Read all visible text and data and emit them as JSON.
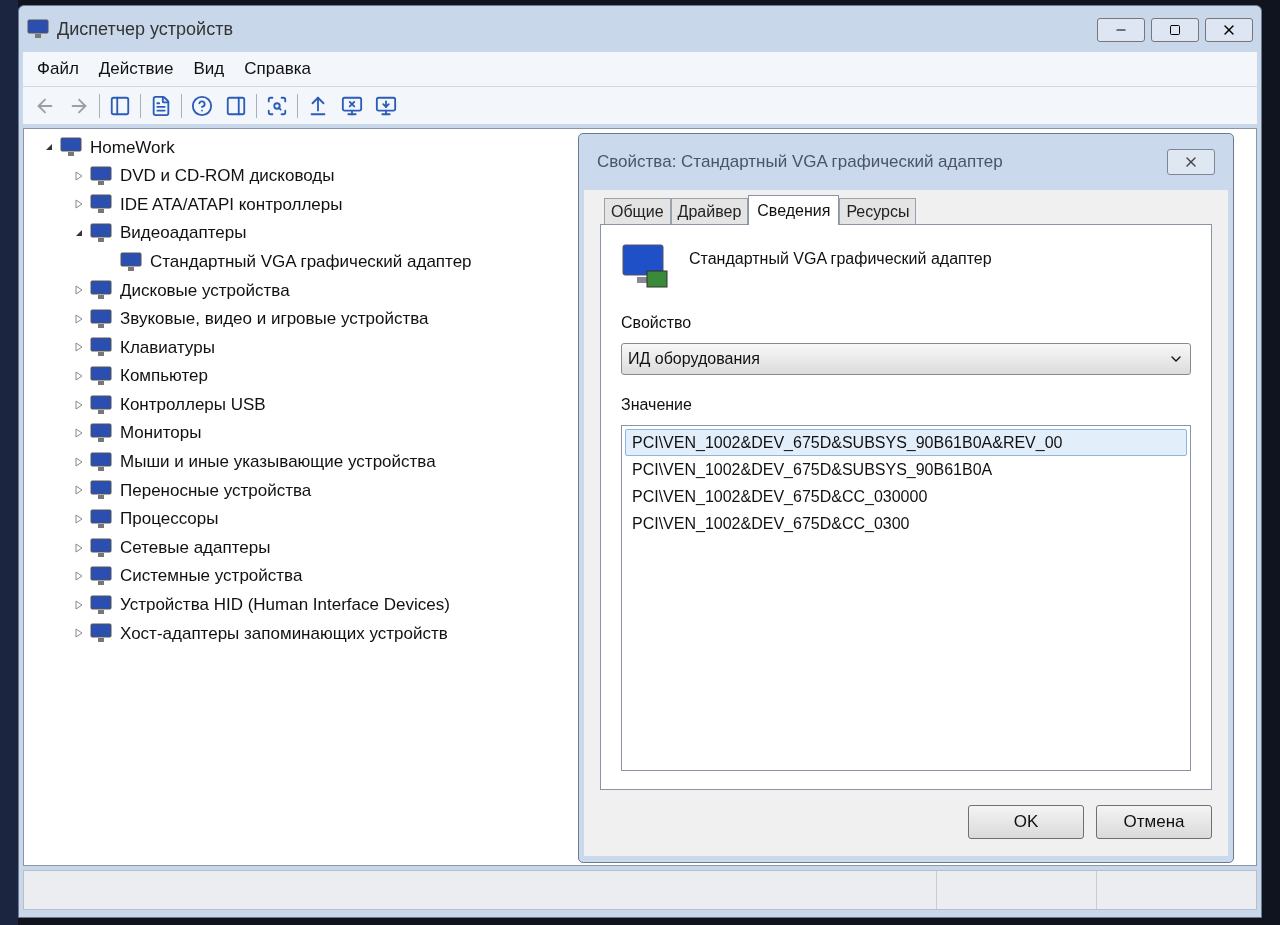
{
  "window": {
    "title": "Диспетчер устройств"
  },
  "menu": [
    "Файл",
    "Действие",
    "Вид",
    "Справка"
  ],
  "toolbar": [
    {
      "disabled": true
    },
    {
      "disabled": true
    },
    {
      "disabled": false
    },
    {
      "disabled": false
    },
    {
      "disabled": false
    },
    {
      "disabled": false
    },
    {
      "disabled": false
    },
    {
      "disabled": false
    },
    {
      "disabled": false
    },
    {
      "disabled": false
    }
  ],
  "tree": [
    {
      "label": "HomeWork",
      "expanded": true,
      "children": [
        {
          "label": "DVD и CD-ROM дисководы",
          "expanded": false
        },
        {
          "label": "IDE ATA/ATAPI контроллеры",
          "expanded": false
        },
        {
          "label": "Видеоадаптеры",
          "expanded": true,
          "children": [
            {
              "label": "Стандартный VGA графический адаптер"
            }
          ]
        },
        {
          "label": "Дисковые устройства",
          "expanded": false
        },
        {
          "label": "Звуковые, видео и игровые устройства",
          "expanded": false
        },
        {
          "label": "Клавиатуры",
          "expanded": false
        },
        {
          "label": "Компьютер",
          "expanded": false
        },
        {
          "label": "Контроллеры USB",
          "expanded": false
        },
        {
          "label": "Мониторы",
          "expanded": false
        },
        {
          "label": "Мыши и иные указывающие устройства",
          "expanded": false
        },
        {
          "label": "Переносные устройства",
          "expanded": false
        },
        {
          "label": "Процессоры",
          "expanded": false
        },
        {
          "label": "Сетевые адаптеры",
          "expanded": false
        },
        {
          "label": "Системные устройства",
          "expanded": false
        },
        {
          "label": "Устройства HID (Human Interface Devices)",
          "expanded": false
        },
        {
          "label": "Хост-адаптеры запоминающих устройств",
          "expanded": false
        }
      ]
    }
  ],
  "dialog": {
    "title": "Свойства: Стандартный VGA графический адаптер",
    "tabs": [
      {
        "label": "Общие",
        "selected": false
      },
      {
        "label": "Драйвер",
        "selected": false
      },
      {
        "label": "Сведения",
        "selected": true
      },
      {
        "label": "Ресурсы",
        "selected": false
      }
    ],
    "device_name": "Стандартный VGA графический адаптер",
    "property_label": "Свойство",
    "property_value": "ИД оборудования",
    "value_label": "Значение",
    "values": [
      {
        "text": "PCI\\VEN_1002&DEV_675D&SUBSYS_90B61B0A&REV_00",
        "selected": true
      },
      {
        "text": "PCI\\VEN_1002&DEV_675D&SUBSYS_90B61B0A",
        "selected": false
      },
      {
        "text": "PCI\\VEN_1002&DEV_675D&CC_030000",
        "selected": false
      },
      {
        "text": "PCI\\VEN_1002&DEV_675D&CC_0300",
        "selected": false
      }
    ],
    "buttons": [
      "OK",
      "Отмена"
    ]
  }
}
